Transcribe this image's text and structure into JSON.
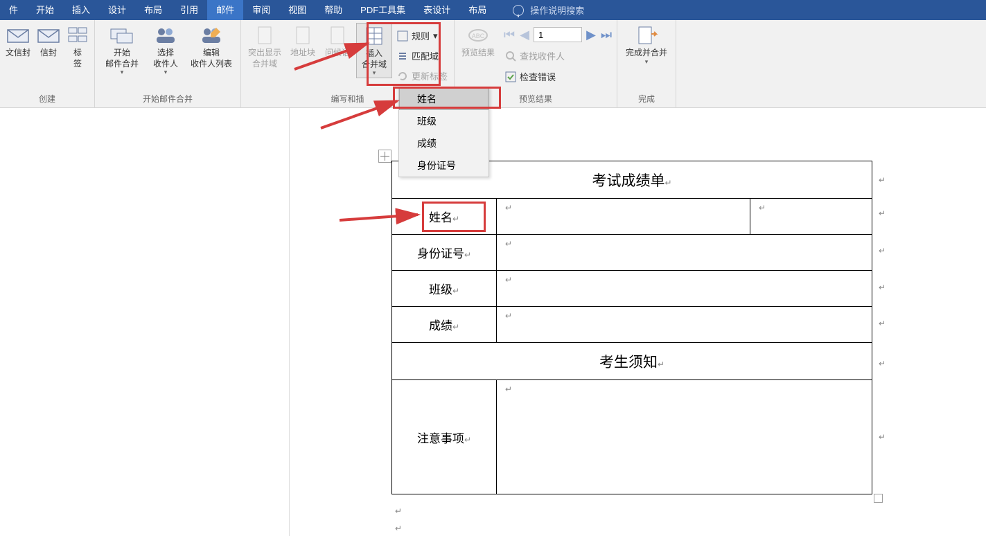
{
  "tabs": [
    "件",
    "开始",
    "插入",
    "设计",
    "布局",
    "引用",
    "邮件",
    "审阅",
    "视图",
    "帮助",
    "PDF工具集",
    "表设计",
    "布局"
  ],
  "tabs_active_index": 6,
  "tell_me": "操作说明搜索",
  "ribbon": {
    "group_create": {
      "label": "创建",
      "btn_chinese_env": "文信封",
      "btn_env": "信封",
      "btn_labels": "标\n签"
    },
    "group_start": {
      "label": "开始邮件合并",
      "btn_start": "开始\n邮件合并",
      "btn_select": "选择\n收件人",
      "btn_edit": "编辑\n收件人列表"
    },
    "group_write": {
      "label": "编写和插",
      "btn_highlight": "突出显示\n合并域",
      "btn_address": "地址块",
      "btn_greeting": "问候语",
      "btn_insert": "插入\n合并域",
      "btn_rules": "规则",
      "btn_match": "匹配域",
      "btn_update": "更新标签"
    },
    "group_preview": {
      "label": "预览结果",
      "btn_preview": "预览结果",
      "record_value": "1",
      "btn_find": "查找收件人",
      "btn_check": "检查错误"
    },
    "group_finish": {
      "label": "完成",
      "btn_finish": "完成并合并"
    }
  },
  "dropdown_items": [
    "姓名",
    "班级",
    "成绩",
    "身份证号"
  ],
  "document": {
    "title": "考试成绩单",
    "rows": [
      {
        "label": "姓名"
      },
      {
        "label": "身份证号"
      },
      {
        "label": "班级"
      },
      {
        "label": "成绩"
      }
    ],
    "section2_title": "考生须知",
    "notes_label": "注意事项"
  }
}
